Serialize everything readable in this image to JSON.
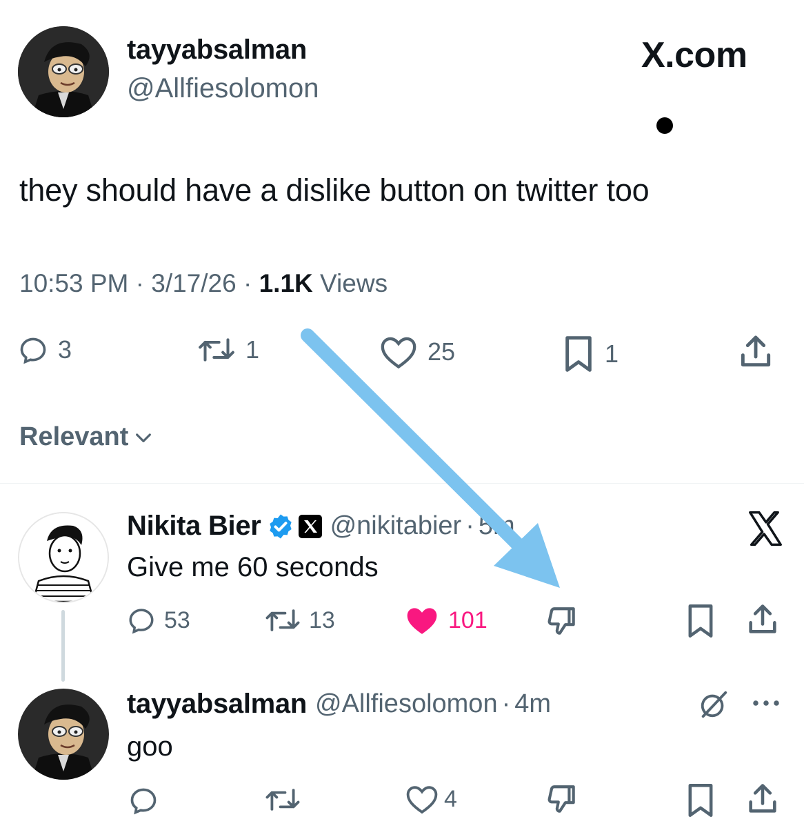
{
  "header": {
    "author_name": "tayyabsalman",
    "author_handle": "@Allfiesolomon",
    "brand_logo": "X.com"
  },
  "tweet": {
    "text": "they should have a dislike button on twitter too",
    "time": "10:53 PM",
    "date": "3/17/26",
    "views_count": "1.1K",
    "views_label": "Views",
    "sep": "·",
    "actions": {
      "replies": "3",
      "reposts": "1",
      "likes": "25",
      "bookmarks": "1"
    }
  },
  "sort": {
    "label": "Relevant"
  },
  "reply1": {
    "name": "Nikita Bier",
    "handle": "@nikitabier",
    "time": "5m",
    "text": "Give me 60 seconds",
    "actions": {
      "replies": "53",
      "reposts": "13",
      "likes": "101"
    }
  },
  "reply2": {
    "name": "tayyabsalman",
    "handle": "@Allfiesolomon",
    "time": "4m",
    "text": "goo",
    "actions": {
      "likes": "4"
    }
  },
  "colors": {
    "text": "#0f1419",
    "secondary": "#536471",
    "verified": "#1d9bf0",
    "like_active": "#f91880",
    "arrow": "#7cc3ef"
  },
  "icons": [
    "reply-icon",
    "repost-icon",
    "heart-icon",
    "bookmark-icon",
    "share-icon",
    "dislike-icon",
    "verified-badge-icon",
    "x-logo-icon",
    "grok-icon",
    "more-icon",
    "chevron-down-icon"
  ]
}
